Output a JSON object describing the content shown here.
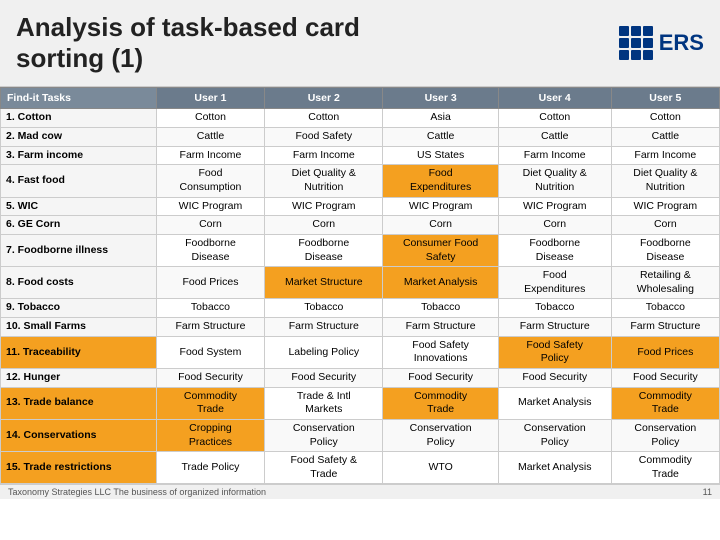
{
  "header": {
    "title_line1": "Analysis of task-based card",
    "title_line2": "sorting (1)",
    "logo_text": "ERS"
  },
  "table": {
    "columns": [
      "Find-it Tasks",
      "User 1",
      "User 2",
      "User 3",
      "User 4",
      "User 5"
    ],
    "rows": [
      {
        "task": "1. Cotton",
        "u1": "Cotton",
        "u2": "Cotton",
        "u3": "Asia",
        "u4": "Cotton",
        "u5": "Cotton",
        "highlight": []
      },
      {
        "task": "2. Mad cow",
        "u1": "Cattle",
        "u2": "Food Safety",
        "u3": "Cattle",
        "u4": "Cattle",
        "u5": "Cattle",
        "highlight": []
      },
      {
        "task": "3. Farm income",
        "u1": "Farm Income",
        "u2": "Farm Income",
        "u3": "US States",
        "u4": "Farm Income",
        "u5": "Farm Income",
        "highlight": []
      },
      {
        "task": "4. Fast food",
        "u1": "Food\nConsumption",
        "u2": "Diet Quality &\nNutrition",
        "u3": "Food\nExpenditures",
        "u4": "Diet Quality &\nNutrition",
        "u5": "Diet Quality &\nNutrition",
        "highlight": [
          "u3"
        ]
      },
      {
        "task": "5. WIC",
        "u1": "WIC Program",
        "u2": "WIC Program",
        "u3": "WIC Program",
        "u4": "WIC Program",
        "u5": "WIC Program",
        "highlight": []
      },
      {
        "task": "6. GE Corn",
        "u1": "Corn",
        "u2": "Corn",
        "u3": "Corn",
        "u4": "Corn",
        "u5": "Corn",
        "highlight": []
      },
      {
        "task": "7. Foodborne illness",
        "u1": "Foodborne\nDisease",
        "u2": "Foodborne\nDisease",
        "u3": "Consumer Food\nSafety",
        "u4": "Foodborne\nDisease",
        "u5": "Foodborne\nDisease",
        "highlight": [
          "u3"
        ]
      },
      {
        "task": "8. Food costs",
        "u1": "Food Prices",
        "u2": "Market Structure",
        "u3": "Market Analysis",
        "u4": "Food\nExpenditures",
        "u5": "Retailing &\nWholesaling",
        "highlight": [
          "u2",
          "u3"
        ]
      },
      {
        "task": "9. Tobacco",
        "u1": "Tobacco",
        "u2": "Tobacco",
        "u3": "Tobacco",
        "u4": "Tobacco",
        "u5": "Tobacco",
        "highlight": []
      },
      {
        "task": "10. Small Farms",
        "u1": "Farm Structure",
        "u2": "Farm Structure",
        "u3": "Farm Structure",
        "u4": "Farm Structure",
        "u5": "Farm Structure",
        "highlight": []
      },
      {
        "task": "11. Traceability",
        "u1": "Food System",
        "u2": "Labeling Policy",
        "u3": "Food Safety\nInnovations",
        "u4": "Food Safety\nPolicy",
        "u5": "Food Prices",
        "highlight": [
          "u4",
          "u5"
        ],
        "row_highlight": true
      },
      {
        "task": "12. Hunger",
        "u1": "Food Security",
        "u2": "Food Security",
        "u3": "Food Security",
        "u4": "Food Security",
        "u5": "Food Security",
        "highlight": []
      },
      {
        "task": "13. Trade balance",
        "u1": "Commodity\nTrade",
        "u2": "Trade & Intl\nMarkets",
        "u3": "Commodity\nTrade",
        "u4": "Market Analysis",
        "u5": "Commodity\nTrade",
        "highlight": [
          "u1",
          "u3",
          "u5"
        ],
        "row_highlight": true
      },
      {
        "task": "14. Conservations",
        "u1": "Cropping\nPractices",
        "u2": "Conservation\nPolicy",
        "u3": "Conservation\nPolicy",
        "u4": "Conservation\nPolicy",
        "u5": "Conservation\nPolicy",
        "highlight": [
          "u1"
        ],
        "row_highlight": true
      },
      {
        "task": "15. Trade restrictions",
        "u1": "Trade Policy",
        "u2": "Food Safety &\nTrade",
        "u3": "WTO",
        "u4": "Market Analysis",
        "u5": "Commodity\nTrade",
        "highlight": [],
        "row_highlight": true
      }
    ]
  },
  "footer": {
    "left": "Taxonomy Strategies LLC  The business of organized information",
    "right": "11"
  }
}
